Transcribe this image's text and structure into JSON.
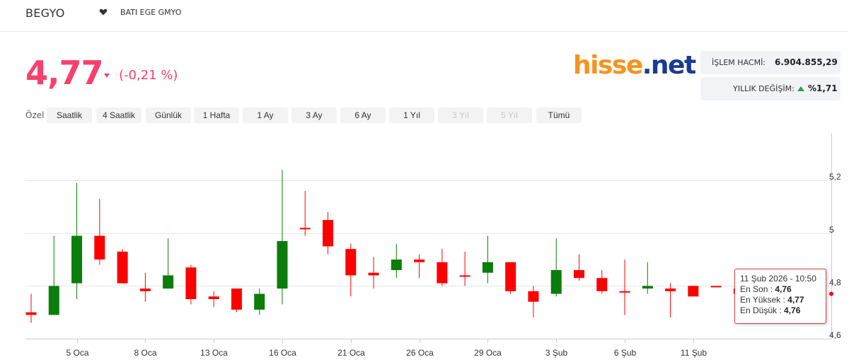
{
  "header": {
    "ticker": "BEGYO",
    "company_name": "BATI EGE GMYO"
  },
  "quote": {
    "price": "4,77",
    "change": "(-0,21 %)",
    "color": "#f7416d"
  },
  "logo": {
    "part1": "hisse",
    "part2": ".net"
  },
  "stats": {
    "volume_label": "İŞLEM HACMİ:",
    "volume_value": "6.904.855,29",
    "yearly_label": "YILLIK DEĞİŞİM:",
    "yearly_value": "%1,71"
  },
  "range": {
    "custom_label": "Özel",
    "buttons": [
      {
        "label": "Saatlik",
        "enabled": true
      },
      {
        "label": "4 Saatlik",
        "enabled": true
      },
      {
        "label": "Günlük",
        "enabled": true
      },
      {
        "label": "1 Hafta",
        "enabled": true
      },
      {
        "label": "1 Ay",
        "enabled": true
      },
      {
        "label": "3 Ay",
        "enabled": true
      },
      {
        "label": "6 Ay",
        "enabled": true
      },
      {
        "label": "1 Yıl",
        "enabled": true
      },
      {
        "label": "3 Yıl",
        "enabled": false
      },
      {
        "label": "5 Yıl",
        "enabled": false
      },
      {
        "label": "Tümü",
        "enabled": true
      }
    ]
  },
  "tooltip": {
    "date": "11 Şub 2026 - 10:50",
    "last_label": "En Son : ",
    "last": "4,76",
    "high_label": "En Yüksek : ",
    "high": "4,77",
    "low_label": "En Düşük : ",
    "low": "4,76"
  },
  "chart_data": {
    "type": "candlestick",
    "up_color": "#0a7d0a",
    "down_color": "#ff0000",
    "y_ticks": [
      "4,6",
      "4,8",
      "5",
      "5,2"
    ],
    "y_tick_values": [
      4.6,
      4.8,
      5.0,
      5.2
    ],
    "ylim": [
      4.6,
      5.38
    ],
    "x_ticks": [
      {
        "label": "5 Oca",
        "index": 2
      },
      {
        "label": "8 Oca",
        "index": 5
      },
      {
        "label": "13 Oca",
        "index": 8
      },
      {
        "label": "16 Oca",
        "index": 11
      },
      {
        "label": "21 Oca",
        "index": 14
      },
      {
        "label": "26 Oca",
        "index": 17
      },
      {
        "label": "29 Oca",
        "index": 20
      },
      {
        "label": "3 Şub",
        "index": 23
      },
      {
        "label": "6 Şub",
        "index": 26
      },
      {
        "label": "11 Şub",
        "index": 29
      }
    ],
    "candles": [
      {
        "open": 4.7,
        "high": 4.77,
        "low": 4.66,
        "close": 4.69
      },
      {
        "open": 4.69,
        "high": 4.99,
        "low": 4.69,
        "close": 4.8
      },
      {
        "open": 4.81,
        "high": 5.19,
        "low": 4.75,
        "close": 4.99
      },
      {
        "open": 4.99,
        "high": 5.13,
        "low": 4.88,
        "close": 4.9
      },
      {
        "open": 4.93,
        "high": 4.94,
        "low": 4.81,
        "close": 4.81
      },
      {
        "open": 4.79,
        "high": 4.85,
        "low": 4.74,
        "close": 4.78
      },
      {
        "open": 4.79,
        "high": 4.98,
        "low": 4.79,
        "close": 4.84
      },
      {
        "open": 4.87,
        "high": 4.88,
        "low": 4.73,
        "close": 4.75
      },
      {
        "open": 4.76,
        "high": 4.78,
        "low": 4.72,
        "close": 4.75
      },
      {
        "open": 4.79,
        "high": 4.79,
        "low": 4.7,
        "close": 4.71
      },
      {
        "open": 4.71,
        "high": 4.79,
        "low": 4.69,
        "close": 4.77
      },
      {
        "open": 4.79,
        "high": 5.24,
        "low": 4.73,
        "close": 4.97
      },
      {
        "open": 5.02,
        "high": 5.16,
        "low": 4.99,
        "close": 5.02
      },
      {
        "open": 5.05,
        "high": 5.08,
        "low": 4.92,
        "close": 4.95
      },
      {
        "open": 4.94,
        "high": 4.96,
        "low": 4.76,
        "close": 4.84
      },
      {
        "open": 4.85,
        "high": 4.91,
        "low": 4.79,
        "close": 4.84
      },
      {
        "open": 4.86,
        "high": 4.96,
        "low": 4.83,
        "close": 4.9
      },
      {
        "open": 4.9,
        "high": 4.92,
        "low": 4.83,
        "close": 4.89
      },
      {
        "open": 4.89,
        "high": 4.94,
        "low": 4.8,
        "close": 4.81
      },
      {
        "open": 4.84,
        "high": 4.93,
        "low": 4.8,
        "close": 4.84
      },
      {
        "open": 4.85,
        "high": 4.99,
        "low": 4.81,
        "close": 4.89
      },
      {
        "open": 4.89,
        "high": 4.89,
        "low": 4.77,
        "close": 4.78
      },
      {
        "open": 4.78,
        "high": 4.8,
        "low": 4.68,
        "close": 4.74
      },
      {
        "open": 4.77,
        "high": 4.98,
        "low": 4.76,
        "close": 4.86
      },
      {
        "open": 4.86,
        "high": 4.92,
        "low": 4.82,
        "close": 4.83
      },
      {
        "open": 4.83,
        "high": 4.86,
        "low": 4.77,
        "close": 4.78
      },
      {
        "open": 4.78,
        "high": 4.9,
        "low": 4.69,
        "close": 4.78
      },
      {
        "open": 4.79,
        "high": 4.89,
        "low": 4.77,
        "close": 4.8
      },
      {
        "open": 4.79,
        "high": 4.81,
        "low": 4.68,
        "close": 4.78
      },
      {
        "open": 4.8,
        "high": 4.8,
        "low": 4.76,
        "close": 4.76
      },
      {
        "open": 4.8,
        "high": 4.8,
        "low": 4.8,
        "close": 4.8
      },
      {
        "open": 4.79,
        "high": 4.8,
        "low": 4.76,
        "close": 4.77
      }
    ]
  }
}
